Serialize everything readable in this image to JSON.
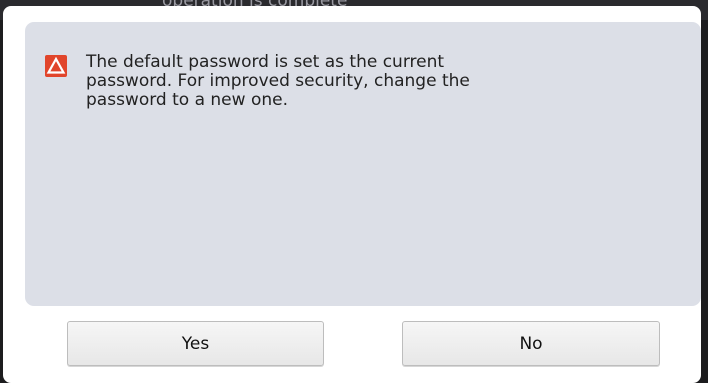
{
  "background": {
    "partial_text": "operation is complete"
  },
  "dialog": {
    "message": "The default password is set as the current password. For improved security, change the password to a new one.",
    "icon": "warning-triangle-icon",
    "yes_label": "Yes",
    "no_label": "No"
  },
  "colors": {
    "warning_icon": "#e1452b",
    "panel": "#dcdfe7",
    "dialog": "#ffffff"
  }
}
